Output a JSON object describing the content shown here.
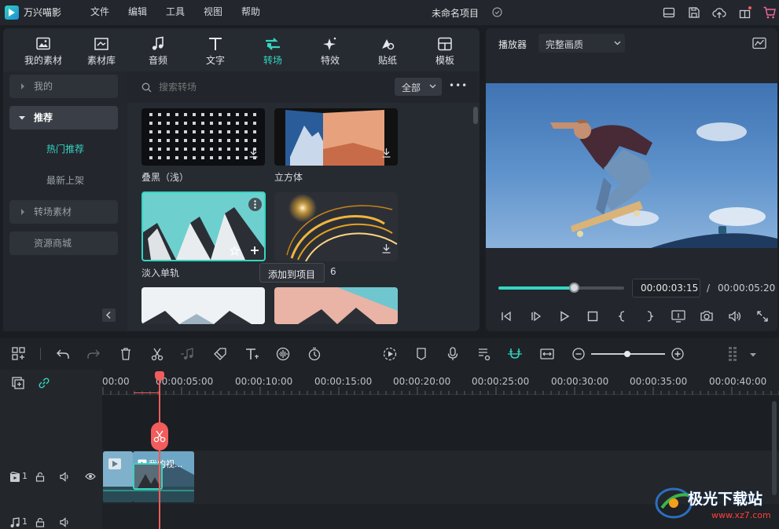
{
  "app": {
    "name": "万兴喵影",
    "project_title": "未命名项目"
  },
  "menu": [
    "文件",
    "编辑",
    "工具",
    "视图",
    "帮助"
  ],
  "library_tabs": [
    {
      "label": "我的素材",
      "icon": "image-icon"
    },
    {
      "label": "素材库",
      "icon": "store-icon"
    },
    {
      "label": "音频",
      "icon": "music-note-icon"
    },
    {
      "label": "文字",
      "icon": "text-icon"
    },
    {
      "label": "转场",
      "icon": "transition-icon",
      "active": true
    },
    {
      "label": "特效",
      "icon": "sparkle-icon"
    },
    {
      "label": "贴纸",
      "icon": "sticker-icon"
    },
    {
      "label": "模板",
      "icon": "template-icon"
    }
  ],
  "sidebar": {
    "mine": "我的",
    "recommended": "推荐",
    "hot": "热门推荐",
    "latest": "最新上架",
    "assets": "转场素材",
    "store": "资源商城"
  },
  "search": {
    "placeholder": "搜索转场",
    "filter": "全部",
    "more": "•••"
  },
  "grid": {
    "items": [
      "叠黑（浅）",
      "立方体",
      "淡入单轨",
      "闪光6"
    ],
    "label_4_visible": "6",
    "tooltip": "添加到项目"
  },
  "player": {
    "label": "播放器",
    "quality": "完整画质",
    "current_time": "00:00:03:15",
    "separator": "/",
    "total_time": "00:00:05:20",
    "progress": 0.6
  },
  "timeline": {
    "ruler": [
      "00:00",
      "00:00:05:00",
      "00:00:10:00",
      "00:00:15:00",
      "00:00:20:00",
      "00:00:25:00",
      "00:00:30:00",
      "00:00:35:00",
      "00:00:40:00"
    ],
    "video_track_num": "1",
    "audio_track_num": "1",
    "clip_title": "我的视..."
  },
  "watermark": {
    "name": "极光下载站",
    "url": "www.xz7.com"
  },
  "colors": {
    "accent": "#34d6c2",
    "playhead": "#f25c5c",
    "bg": "#1a1d22"
  }
}
